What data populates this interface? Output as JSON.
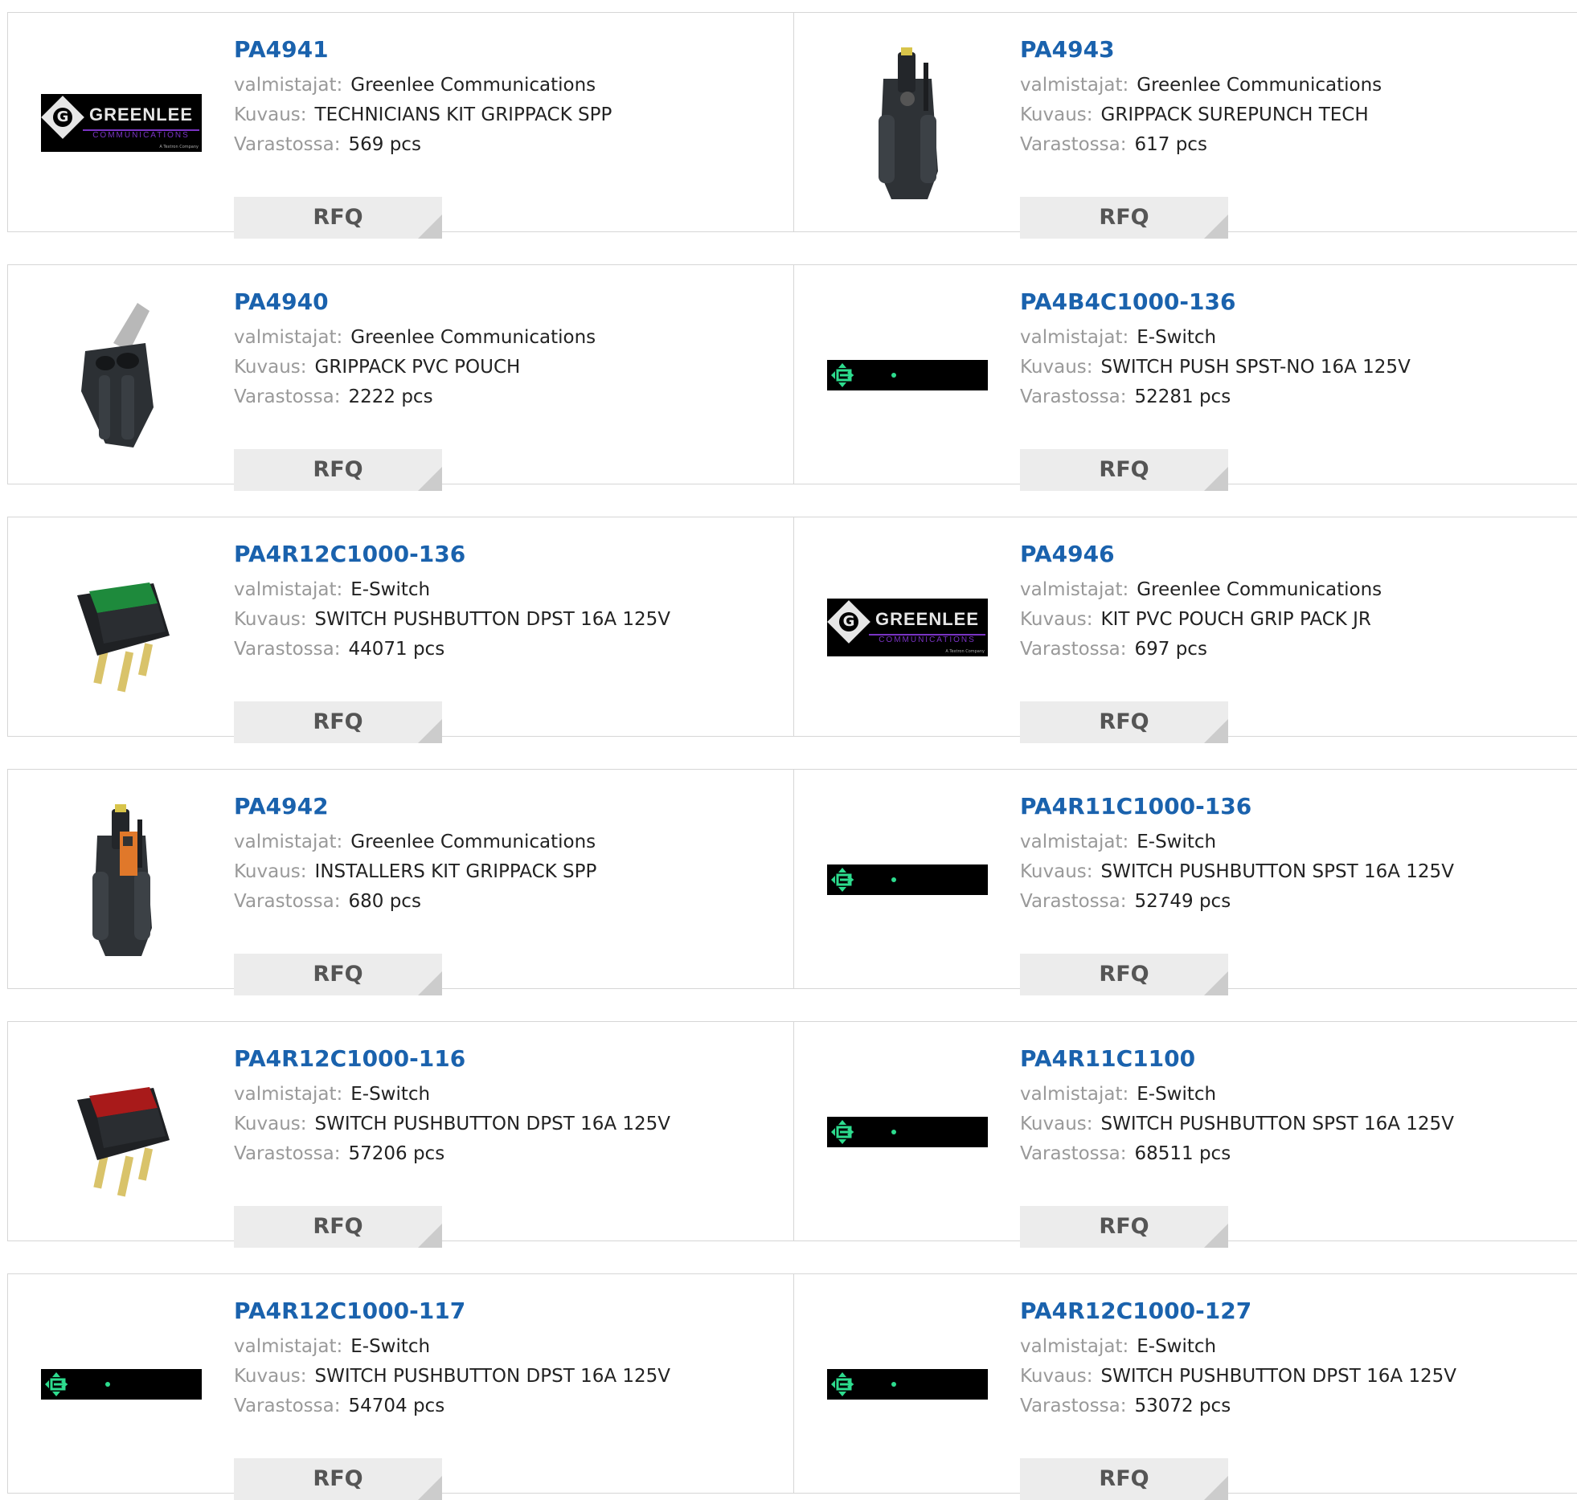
{
  "labels": {
    "manufacturer": "valmistajat:",
    "description": "Kuvaus:",
    "stock": "Varastossa:",
    "rfq": "RFQ"
  },
  "logo": {
    "greenlee_word": "GREENLEE",
    "greenlee_sub": "COMMUNICATIONS",
    "greenlee_small": "A Textron Company",
    "g_letter": "G"
  },
  "products": [
    {
      "part": "PA4941",
      "manufacturer": "Greenlee Communications",
      "description": "TECHNICIANS KIT GRIPPACK SPP",
      "stock": "569 pcs",
      "image": "greenlee-logo"
    },
    {
      "part": "PA4943",
      "manufacturer": "Greenlee Communications",
      "description": "GRIPPACK SUREPUNCH TECH",
      "stock": "617 pcs",
      "image": "grippack-tech"
    },
    {
      "part": "PA4940",
      "manufacturer": "Greenlee Communications",
      "description": "GRIPPACK PVC POUCH",
      "stock": "2222 pcs",
      "image": "pvc-pouch"
    },
    {
      "part": "PA4B4C1000-136",
      "manufacturer": "E-Switch",
      "description": "SWITCH PUSH SPST-NO 16A 125V",
      "stock": "52281 pcs",
      "image": "eswitch-logo"
    },
    {
      "part": "PA4R12C1000-136",
      "manufacturer": "E-Switch",
      "description": "SWITCH PUSHBUTTON DPST 16A 125V",
      "stock": "44071 pcs",
      "image": "green-switch"
    },
    {
      "part": "PA4946",
      "manufacturer": "Greenlee Communications",
      "description": "KIT PVC POUCH GRIP PACK JR",
      "stock": "697 pcs",
      "image": "greenlee-logo"
    },
    {
      "part": "PA4942",
      "manufacturer": "Greenlee Communications",
      "description": "INSTALLERS KIT GRIPPACK SPP",
      "stock": "680 pcs",
      "image": "grippack-installer"
    },
    {
      "part": "PA4R11C1000-136",
      "manufacturer": "E-Switch",
      "description": "SWITCH PUSHBUTTON SPST 16A 125V",
      "stock": "52749 pcs",
      "image": "eswitch-logo"
    },
    {
      "part": "PA4R12C1000-116",
      "manufacturer": "E-Switch",
      "description": "SWITCH PUSHBUTTON DPST 16A 125V",
      "stock": "57206 pcs",
      "image": "red-switch"
    },
    {
      "part": "PA4R11C1100",
      "manufacturer": "E-Switch",
      "description": "SWITCH PUSHBUTTON SPST 16A 125V",
      "stock": "68511 pcs",
      "image": "eswitch-logo"
    },
    {
      "part": "PA4R12C1000-117",
      "manufacturer": "E-Switch",
      "description": "SWITCH PUSHBUTTON DPST 16A 125V",
      "stock": "54704 pcs",
      "image": "eswitch-logo"
    },
    {
      "part": "PA4R12C1000-127",
      "manufacturer": "E-Switch",
      "description": "SWITCH PUSHBUTTON DPST 16A 125V",
      "stock": "53072 pcs",
      "image": "eswitch-logo"
    }
  ],
  "colors": {
    "part_link": "#1a62ad",
    "label": "#999999",
    "value": "#222222",
    "rfq_bg": "#ececec",
    "border": "#d6d6d6",
    "eswitch_accent": "#2ddc8e",
    "greenlee_purple": "#7a33c4"
  }
}
